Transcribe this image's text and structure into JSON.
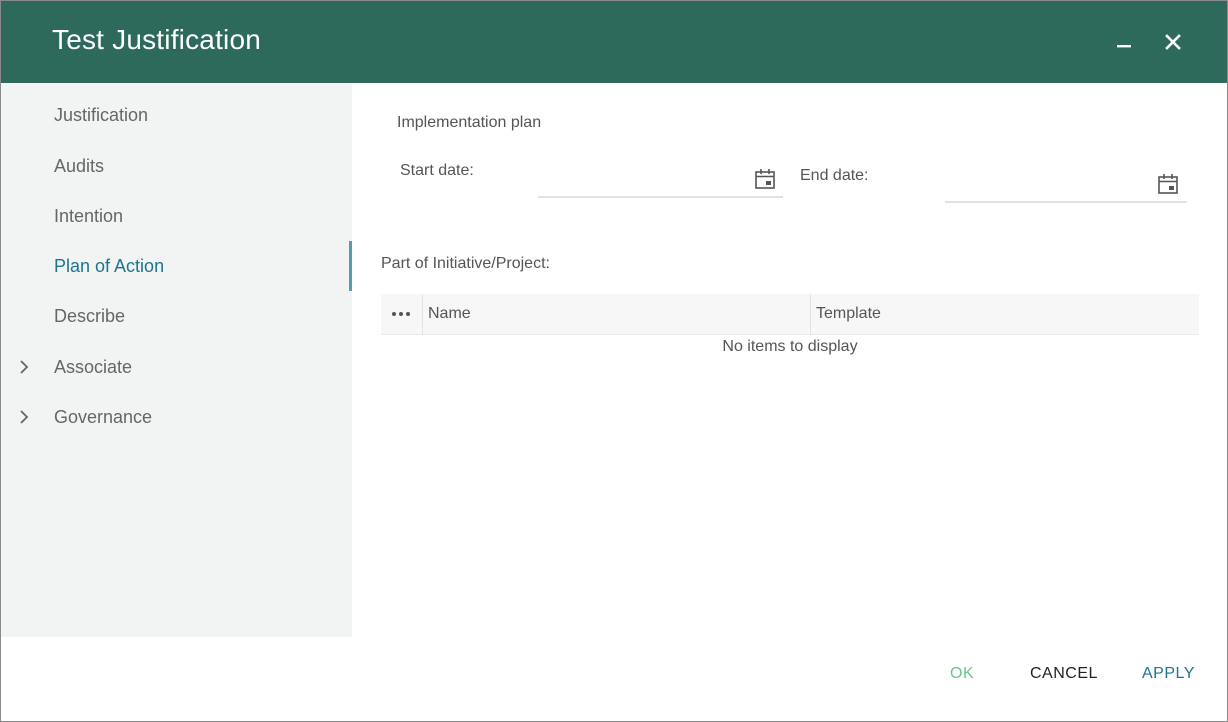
{
  "window": {
    "title": "Test Justification",
    "minimize_icon": "minimize-icon",
    "close_icon": "close-icon",
    "header_color": "#2d6a5c"
  },
  "sidebar": {
    "items": [
      {
        "label": "Justification",
        "active": false,
        "expandable": false
      },
      {
        "label": "Audits",
        "active": false,
        "expandable": false
      },
      {
        "label": "Intention",
        "active": false,
        "expandable": false
      },
      {
        "label": "Plan of Action",
        "active": true,
        "expandable": false
      },
      {
        "label": "Describe",
        "active": false,
        "expandable": false
      },
      {
        "label": "Associate",
        "active": false,
        "expandable": true
      },
      {
        "label": "Governance",
        "active": false,
        "expandable": true
      }
    ],
    "active_color": "#1e7390"
  },
  "plan": {
    "section_title": "Implementation plan",
    "start_label": "Start date:",
    "start_value": "",
    "end_label": "End date:",
    "end_value": "",
    "calendar_icon": "calendar-icon"
  },
  "initiative": {
    "label": "Part of Initiative/Project:",
    "columns": [
      "Name",
      "Template"
    ],
    "menu_icon": "more-horizontal-icon",
    "empty_message": "No items to display"
  },
  "footer": {
    "ok_label": "OK",
    "cancel_label": "CANCEL",
    "apply_label": "APPLY",
    "ok_color": "#6cc48a",
    "cancel_color": "#222222",
    "apply_color": "#1e7390"
  }
}
